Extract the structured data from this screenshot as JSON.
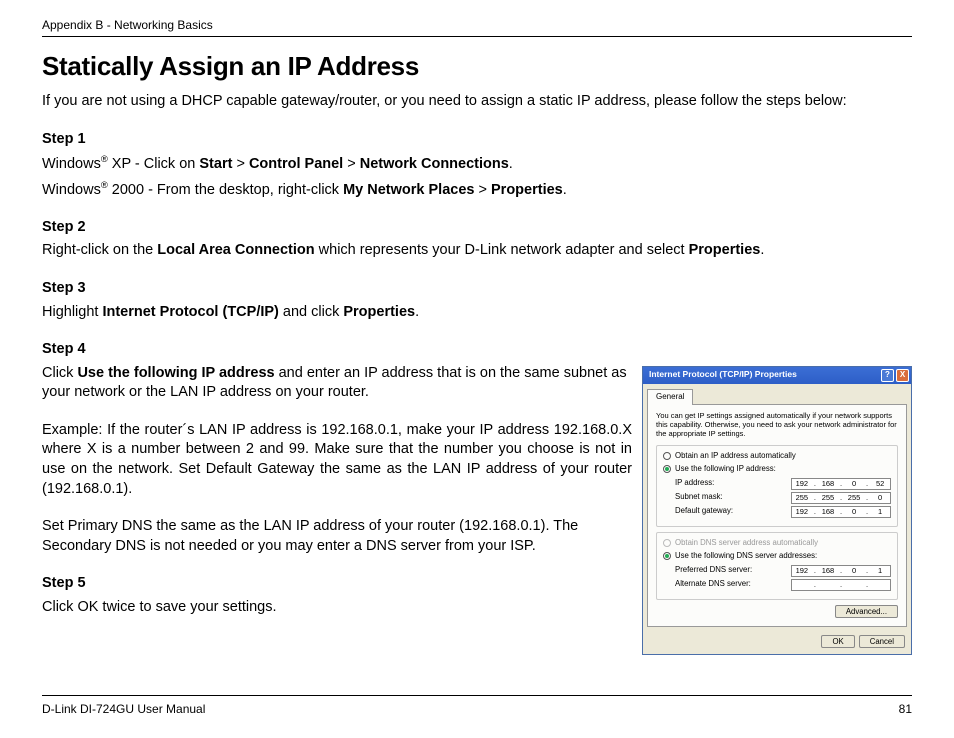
{
  "header": "Appendix B - Networking Basics",
  "title": "Statically Assign an IP Address",
  "intro": "If you are not using a DHCP capable gateway/router, or you need to assign a static IP address, please follow the steps below:",
  "steps": {
    "s1": "Step 1",
    "s1a_pre": "Windows",
    "s1a_mid": " XP - Click on ",
    "s1a_b1": "Start",
    "s1a_sep": " > ",
    "s1a_b2": "Control Panel",
    "s1a_b3": "Network Connections",
    "s1b_pre": "Windows",
    "s1b_mid": " 2000 - From the desktop, right-click ",
    "s1b_b1": "My Network Places",
    "s1b_b2": "Properties",
    "s2": "Step 2",
    "s2a_pre": "Right-click on the ",
    "s2a_b1": "Local Area Connection",
    "s2a_mid": " which represents your D-Link network adapter and select ",
    "s2a_b2": "Properties",
    "s3": "Step 3",
    "s3a_pre": "Highlight ",
    "s3a_b1": "Internet Protocol (TCP/IP)",
    "s3a_mid": " and click ",
    "s3a_b2": "Properties",
    "s4": "Step 4",
    "s4a_pre": "Click ",
    "s4a_b1": "Use the following IP address",
    "s4a_post": " and enter an IP address that is on the same subnet as your network or the LAN IP address on your router.",
    "s4b": "Example: If the router´s LAN IP address is 192.168.0.1, make your IP address 192.168.0.X where X is a number between 2 and 99. Make sure that the number you choose is not in use on the network. Set Default Gateway the same as the LAN IP address of your router (192.168.0.1).",
    "s4c": "Set Primary DNS the same as the LAN IP address of your router (192.168.0.1). The Secondary DNS is not needed or you may enter a DNS server from your ISP.",
    "s5": "Step 5",
    "s5a": "Click OK twice to save your settings."
  },
  "dialog": {
    "title": "Internet Protocol (TCP/IP) Properties",
    "help": "?",
    "close": "X",
    "tab": "General",
    "desc": "You can get IP settings assigned automatically if your network supports this capability. Otherwise, you need to ask your network administrator for the appropriate IP settings.",
    "r1": "Obtain an IP address automatically",
    "r2": "Use the following IP address:",
    "f1": "IP address:",
    "f2": "Subnet mask:",
    "f3": "Default gateway:",
    "r3": "Obtain DNS server address automatically",
    "r4": "Use the following DNS server addresses:",
    "f4": "Preferred DNS server:",
    "f5": "Alternate DNS server:",
    "ip1": {
      "a": "192",
      "b": "168",
      "c": "0",
      "d": "52"
    },
    "ip2": {
      "a": "255",
      "b": "255",
      "c": "255",
      "d": "0"
    },
    "ip3": {
      "a": "192",
      "b": "168",
      "c": "0",
      "d": "1"
    },
    "ip4": {
      "a": "192",
      "b": "168",
      "c": "0",
      "d": "1"
    },
    "adv": "Advanced...",
    "ok": "OK",
    "cancel": "Cancel"
  },
  "footer": {
    "left": "D-Link DI-724GU User Manual",
    "right": "81"
  }
}
